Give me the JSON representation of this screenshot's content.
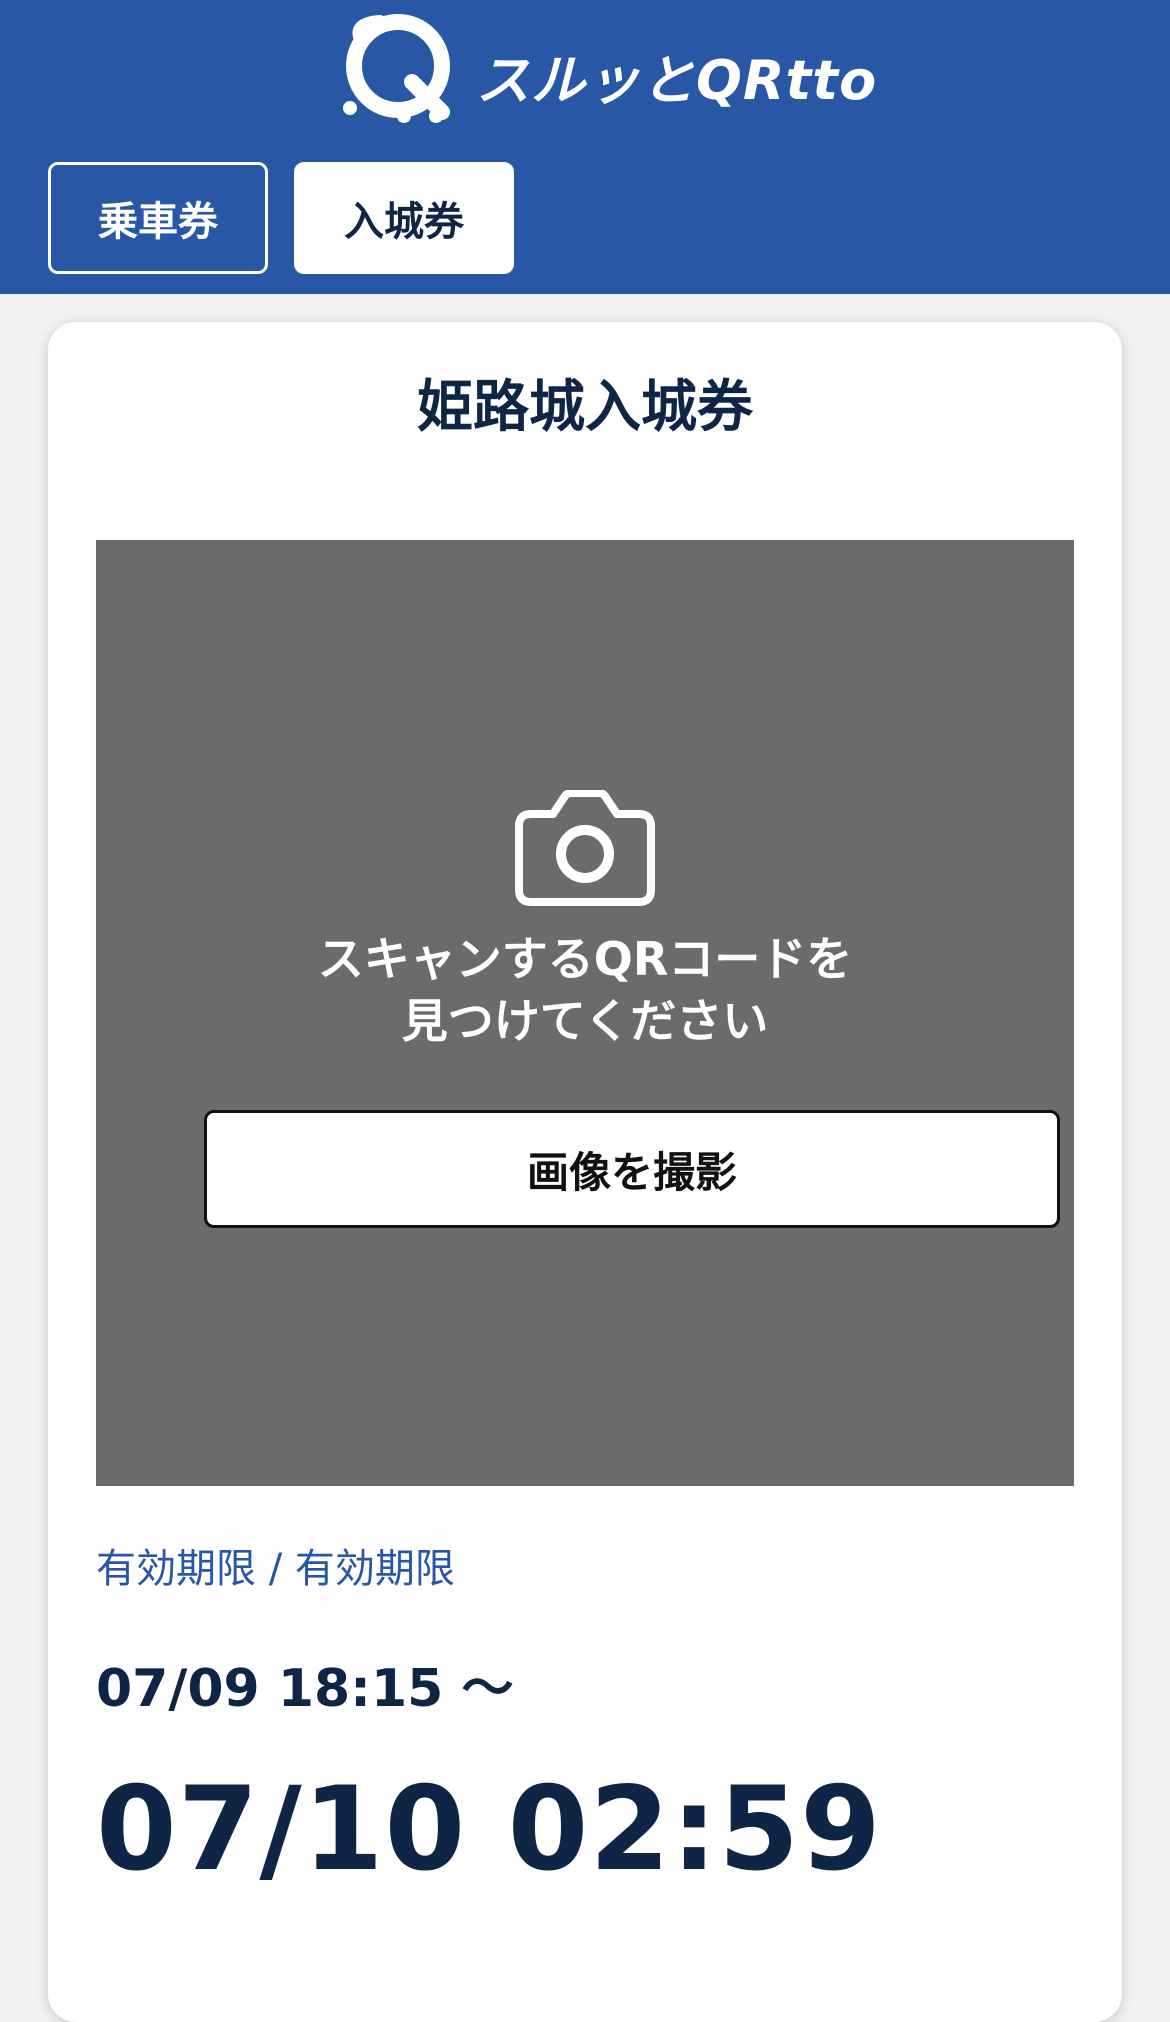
{
  "header": {
    "logo_text": "スルッとQRtto",
    "tabs": [
      {
        "label": "乗車券",
        "active": false
      },
      {
        "label": "入城券",
        "active": true
      }
    ],
    "background_color": "#2858a5"
  },
  "ticket": {
    "title": "姫路城入城券",
    "scanner": {
      "icon": "camera-icon",
      "message": "スキャンするQRコードを\n見つけてください",
      "capture_button_label": "画像を撮影"
    },
    "validity": {
      "label": "有効期限 / 有効期限",
      "from": "07/09 18:15 〜",
      "to": "07/10 02:59"
    }
  }
}
